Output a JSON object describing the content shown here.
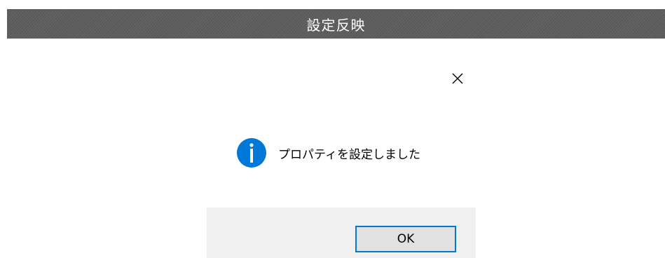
{
  "window": {
    "title": "設定反映"
  },
  "dialog": {
    "message": "プロパティを設定しました",
    "icon": "info-icon",
    "close_icon": "close-icon",
    "ok_label": "OK"
  },
  "colors": {
    "title_bar": "#5a5a5a",
    "title_text": "#ffffff",
    "info_icon": "#0078d7",
    "button_border": "#0078d7",
    "button_area": "#f0f0f0",
    "button_face": "#e1e1e1"
  }
}
